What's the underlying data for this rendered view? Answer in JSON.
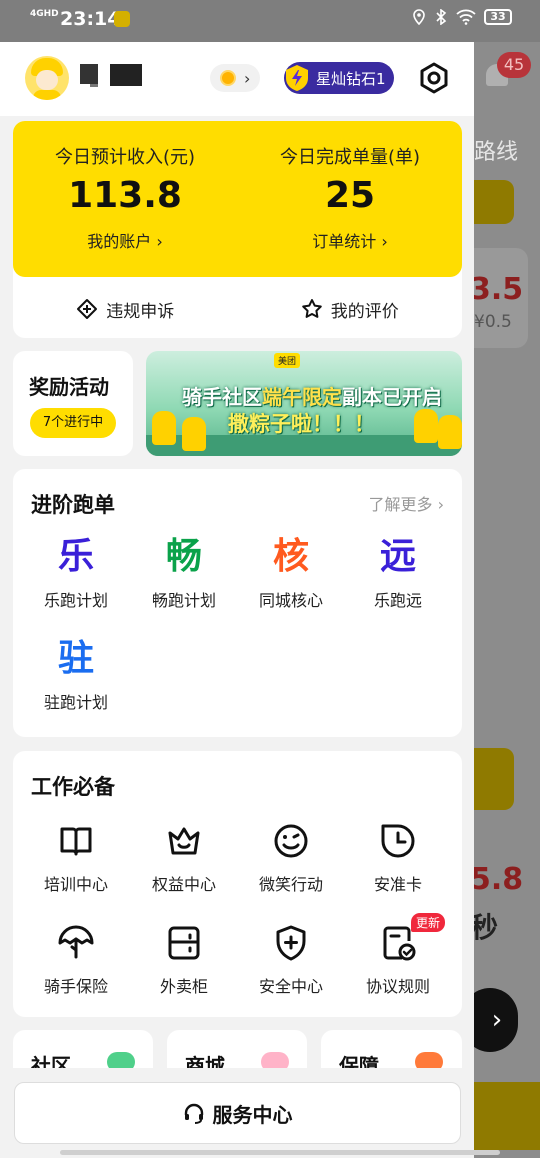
{
  "status_bar": {
    "network": "4GHD",
    "time": "23:14",
    "battery": "33"
  },
  "background": {
    "route_label": "路线",
    "badge_count": "45",
    "amount1": "3.5",
    "amount1_sub": "¥0.5",
    "amount2": "5.8",
    "char1": "秒",
    "fab_arrow": "›"
  },
  "header": {
    "level_badge": "星灿钻石1",
    "coin_arrow": "›"
  },
  "stats": {
    "income_label": "今日预计收入(元)",
    "income_value": "113.8",
    "account_link": "我的账户",
    "orders_label": "今日完成单量(单)",
    "orders_value": "25",
    "order_stats_link": "订单统计",
    "appeal_label": "违规申诉",
    "review_label": "我的评价"
  },
  "rewards": {
    "title": "奖励活动",
    "badge": "7个进行中",
    "banner_brand": "美团",
    "banner_line1_a": "骑手社区",
    "banner_line1_b": "端午限定",
    "banner_line1_c": "副本已开启",
    "banner_line2": "撒粽子啦！！！"
  },
  "advanced": {
    "title": "进阶跑单",
    "more": "了解更多 ›",
    "items": [
      {
        "glyph": "乐",
        "label": "乐跑计划",
        "color": "#3a20d8"
      },
      {
        "glyph": "畅",
        "label": "畅跑计划",
        "color": "#0aa24a"
      },
      {
        "glyph": "核",
        "label": "同城核心",
        "color": "#ff5a1f"
      },
      {
        "glyph": "远",
        "label": "乐跑远",
        "color": "#3a20d8"
      },
      {
        "glyph": "驻",
        "label": "驻跑计划",
        "color": "#1a6df0"
      }
    ]
  },
  "essentials": {
    "title": "工作必备",
    "items": [
      {
        "label": "培训中心"
      },
      {
        "label": "权益中心"
      },
      {
        "label": "微笑行动"
      },
      {
        "label": "安准卡"
      },
      {
        "label": "骑手保险"
      },
      {
        "label": "外卖柜"
      },
      {
        "label": "安全中心"
      },
      {
        "label": "协议规则",
        "badge": "更新"
      }
    ]
  },
  "bottom_cards": [
    {
      "title": "社区"
    },
    {
      "title": "商城"
    },
    {
      "title": "保障"
    }
  ],
  "service": {
    "label": "服务中心"
  }
}
